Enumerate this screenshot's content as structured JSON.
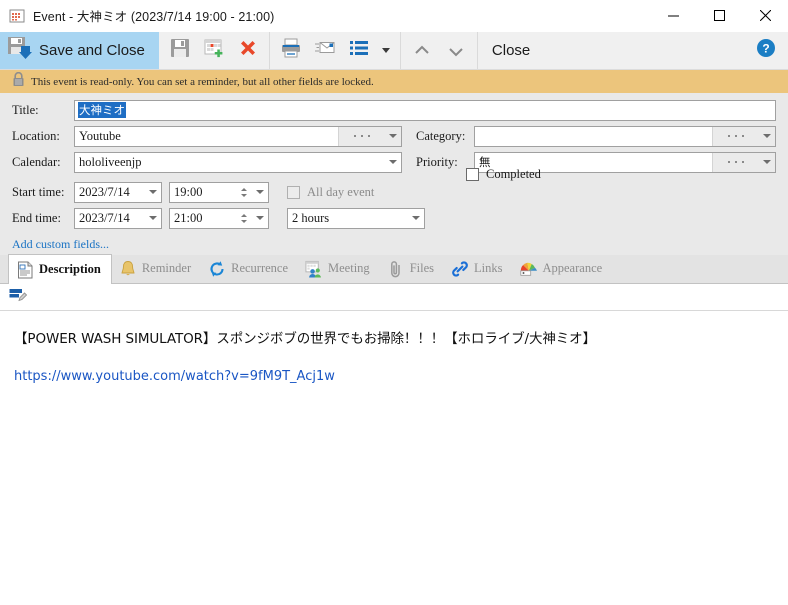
{
  "window": {
    "title": "Event - 大神ミオ (2023/7/14 19:00 - 21:00)",
    "icon": "calendar-icon",
    "minimize": "—",
    "maximize": "☐",
    "close": "✕"
  },
  "toolbar": {
    "save_and_close": "Save and Close",
    "buttons": [
      {
        "name": "save-button",
        "icon": "floppy-disk-icon"
      },
      {
        "name": "new-event-button",
        "icon": "calendar-plus-icon"
      },
      {
        "name": "delete-button",
        "icon": "red-x-icon"
      },
      {
        "name": "print-button",
        "icon": "printer-icon"
      },
      {
        "name": "send-email-button",
        "icon": "envelope-icon"
      },
      {
        "name": "list-view-button",
        "icon": "list-icon"
      }
    ],
    "prev_label": "previous-event",
    "next_label": "next-event",
    "close_label": "Close",
    "help_label": "?"
  },
  "infobar": {
    "icon": "lock-icon",
    "message": "This event is read-only. You can set a reminder, but all other fields are locked."
  },
  "form": {
    "title_label": "Title:",
    "title_value": "大神ミオ",
    "location_label": "Location:",
    "location_value": "Youtube",
    "calendar_label": "Calendar:",
    "calendar_value": "hololiveenjp",
    "category_label": "Category:",
    "category_value": "",
    "priority_label": "Priority:",
    "priority_value": "無",
    "start_time_label": "Start time:",
    "start_date_value": "2023/7/14",
    "start_clock_value": "19:00",
    "end_time_label": "End time:",
    "end_date_value": "2023/7/14",
    "end_clock_value": "21:00",
    "all_day_label": "All day event",
    "duration_value": "2 hours",
    "completed_label": "Completed",
    "add_custom_fields": "Add custom fields..."
  },
  "tabs": [
    {
      "label": "Description",
      "icon": "document-icon",
      "active": true
    },
    {
      "label": "Reminder",
      "icon": "bell-icon",
      "active": false
    },
    {
      "label": "Recurrence",
      "icon": "refresh-circle-icon",
      "active": false
    },
    {
      "label": "Meeting",
      "icon": "people-calendar-icon",
      "active": false
    },
    {
      "label": "Files",
      "icon": "paperclip-icon",
      "active": false
    },
    {
      "label": "Links",
      "icon": "chain-link-icon",
      "active": false
    },
    {
      "label": "Appearance",
      "icon": "color-fan-icon",
      "active": false
    }
  ],
  "description": {
    "edit_icon": "note-edit-icon",
    "text": "【POWER WASH SIMULATOR】スポンジボブの世界でもお掃除！！！【ホロライブ/大神ミオ】",
    "url": "https://www.youtube.com/watch?v=9fM9T_Acj1w"
  },
  "colors": {
    "accent_blue": "#a8d5f2",
    "info_bar": "#ecc57c",
    "link": "#1a73c4",
    "selection": "#1f6ec4",
    "danger": "#e8482a"
  }
}
